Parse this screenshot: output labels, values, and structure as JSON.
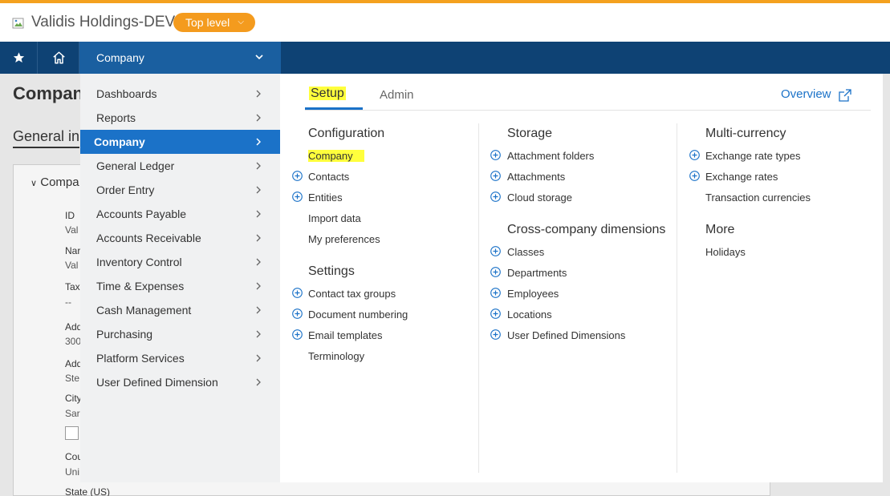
{
  "header": {
    "company_name": "Validis Holdings-DEV",
    "level_button": "Top level",
    "accent_color": "#f4a11e"
  },
  "navbar": {
    "star_icon": "star-icon",
    "home_icon": "home-icon",
    "module": "Company",
    "bar_color": "#0e4274"
  },
  "background_page": {
    "title": "Compan",
    "tab": "General in",
    "section": "Compa",
    "fields": [
      {
        "label": "ID",
        "value": "Val"
      },
      {
        "label": "Nar",
        "value": "Val"
      },
      {
        "label": "Tax",
        "value": "--"
      },
      {
        "label": "Add",
        "value": "300"
      },
      {
        "label": "Add",
        "value": "Ste"
      },
      {
        "label": "City",
        "value": "Sar"
      },
      {
        "label": "Cou",
        "value": "Uni"
      },
      {
        "label": "State (US)",
        "value": ""
      }
    ]
  },
  "menu": {
    "items": [
      {
        "label": "Dashboards"
      },
      {
        "label": "Reports"
      },
      {
        "label": "Company"
      },
      {
        "label": "General Ledger"
      },
      {
        "label": "Order Entry"
      },
      {
        "label": "Accounts Payable"
      },
      {
        "label": "Accounts Receivable"
      },
      {
        "label": "Inventory Control"
      },
      {
        "label": "Time & Expenses"
      },
      {
        "label": "Cash Management"
      },
      {
        "label": "Purchasing"
      },
      {
        "label": "Platform Services"
      },
      {
        "label": "User Defined Dimension"
      }
    ],
    "active_item": "Company",
    "active_color": "#1b72c8"
  },
  "submenu": {
    "tabs": {
      "setup": "Setup",
      "admin": "Admin"
    },
    "overview": "Overview",
    "highlight_color": "#ffff3c",
    "col1": {
      "configuration_head": "Configuration",
      "configuration": [
        {
          "label": "Company",
          "plus": false
        },
        {
          "label": "Contacts",
          "plus": true
        },
        {
          "label": "Entities",
          "plus": true
        },
        {
          "label": "Import data",
          "plus": false
        },
        {
          "label": "My preferences",
          "plus": false
        }
      ],
      "settings_head": "Settings",
      "settings": [
        {
          "label": "Contact tax groups",
          "plus": true
        },
        {
          "label": "Document numbering",
          "plus": true
        },
        {
          "label": "Email templates",
          "plus": true
        },
        {
          "label": "Terminology",
          "plus": false
        }
      ]
    },
    "col2": {
      "storage_head": "Storage",
      "storage": [
        {
          "label": "Attachment folders",
          "plus": true
        },
        {
          "label": "Attachments",
          "plus": true
        },
        {
          "label": "Cloud storage",
          "plus": true
        }
      ],
      "dimensions_head": "Cross-company dimensions",
      "dimensions": [
        {
          "label": "Classes",
          "plus": true
        },
        {
          "label": "Departments",
          "plus": true
        },
        {
          "label": "Employees",
          "plus": true
        },
        {
          "label": "Locations",
          "plus": true
        },
        {
          "label": "User Defined Dimensions",
          "plus": true
        }
      ]
    },
    "col3": {
      "currency_head": "Multi-currency",
      "currency": [
        {
          "label": "Exchange rate types",
          "plus": true
        },
        {
          "label": "Exchange rates",
          "plus": true
        },
        {
          "label": "Transaction currencies",
          "plus": false
        }
      ],
      "more_head": "More",
      "more": [
        {
          "label": "Holidays",
          "plus": false
        }
      ]
    }
  }
}
